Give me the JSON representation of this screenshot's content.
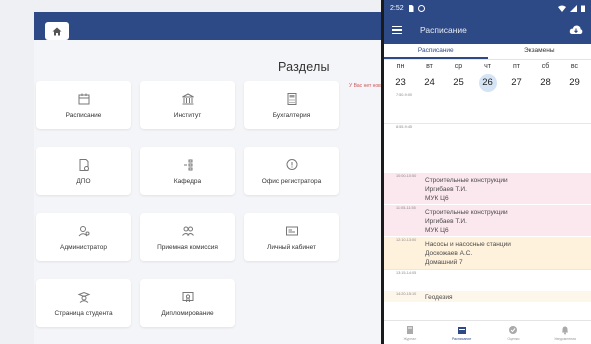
{
  "web": {
    "title": "Разделы",
    "marquee_text": "У Вас нет новых уведомлений",
    "tiles": [
      {
        "label": "Расписание"
      },
      {
        "label": "Институт"
      },
      {
        "label": "Бухгалтерия"
      },
      {
        "label": "ДПО"
      },
      {
        "label": "Кафедра"
      },
      {
        "label": "Офис регистратора"
      },
      {
        "label": "Администратор"
      },
      {
        "label": "Приемная комиссия"
      },
      {
        "label": "Личный кабинет"
      },
      {
        "label": "Страница студента"
      },
      {
        "label": "Дипломирование"
      }
    ]
  },
  "phone": {
    "status": {
      "time": "2:52"
    },
    "appbar": {
      "title": "Расписание"
    },
    "tabs": [
      {
        "label": "Расписание"
      },
      {
        "label": "Экзамены"
      }
    ],
    "days": [
      {
        "name": "пн",
        "num": "23"
      },
      {
        "name": "вт",
        "num": "24"
      },
      {
        "name": "ср",
        "num": "25"
      },
      {
        "name": "чт",
        "num": "26"
      },
      {
        "name": "пт",
        "num": "27"
      },
      {
        "name": "сб",
        "num": "28"
      },
      {
        "name": "вс",
        "num": "29"
      }
    ],
    "slots": [
      {
        "time": "7:50-9:00",
        "lines": []
      },
      {
        "time": "8:55-9:45",
        "lines": []
      },
      {
        "time": "10:00-10:50",
        "lines": [
          "Строительные конструкции",
          "Иргибаев Т.И.",
          "МУК Ц6"
        ]
      },
      {
        "time": "11:05-11:55",
        "lines": [
          "Строительные конструкции",
          "Иргибаев Т.И.",
          "МУК Ц6"
        ]
      },
      {
        "time": "12:10-13:00",
        "lines": [
          "Насосы и насосные станции",
          "Доскожаев А.С.",
          "Домашний 7"
        ]
      },
      {
        "time": "13:15-14:05",
        "lines": []
      },
      {
        "time": "14:20-15:10",
        "lines": [
          "Геодезия"
        ]
      }
    ],
    "nav": [
      {
        "label": "Журнал"
      },
      {
        "label": "Расписание"
      },
      {
        "label": "Оценки"
      },
      {
        "label": "Уведомления"
      }
    ]
  },
  "colors": {
    "brand": "#2e4a86",
    "event_pink": "#fbe8ee",
    "event_orange": "#fff2dc",
    "event_light": "#fdf6ea",
    "selected_day": "#d4e4f4"
  }
}
